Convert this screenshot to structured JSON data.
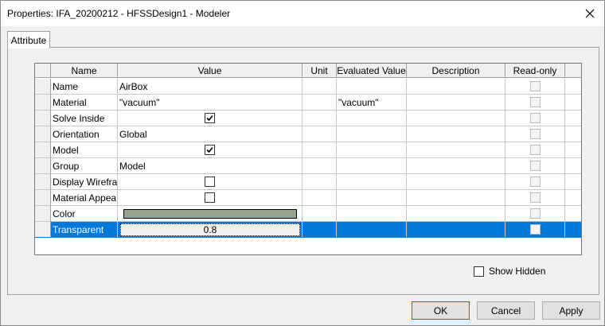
{
  "window": {
    "title": "Properties: IFA_20200212 - HFSSDesign1 - Modeler"
  },
  "tabs": [
    {
      "label": "Attribute"
    }
  ],
  "grid": {
    "columns": [
      "Name",
      "Value",
      "Unit",
      "Evaluated Value",
      "Description",
      "Read-only"
    ],
    "rows": [
      {
        "name": "Name",
        "value": "AirBox",
        "unit": "",
        "evaluated": "",
        "description": "",
        "value_type": "text"
      },
      {
        "name": "Material",
        "value": "\"vacuum\"",
        "unit": "",
        "evaluated": "\"vacuum\"",
        "description": "",
        "value_type": "text"
      },
      {
        "name": "Solve Inside",
        "value": "",
        "unit": "",
        "evaluated": "",
        "description": "",
        "value_type": "checkbox",
        "checked": true
      },
      {
        "name": "Orientation",
        "value": "Global",
        "unit": "",
        "evaluated": "",
        "description": "",
        "value_type": "text"
      },
      {
        "name": "Model",
        "value": "",
        "unit": "",
        "evaluated": "",
        "description": "",
        "value_type": "checkbox",
        "checked": true
      },
      {
        "name": "Group",
        "value": "Model",
        "unit": "",
        "evaluated": "",
        "description": "",
        "value_type": "text"
      },
      {
        "name": "Display Wirefra...",
        "value": "",
        "unit": "",
        "evaluated": "",
        "description": "",
        "value_type": "checkbox",
        "checked": false
      },
      {
        "name": "Material Appea...",
        "value": "",
        "unit": "",
        "evaluated": "",
        "description": "",
        "value_type": "checkbox",
        "checked": false
      },
      {
        "name": "Color",
        "value": "",
        "unit": "",
        "evaluated": "",
        "description": "",
        "value_type": "color",
        "color": "#95a58d"
      },
      {
        "name": "Transparent",
        "value": "0.8",
        "unit": "",
        "evaluated": "",
        "description": "",
        "value_type": "editor",
        "selected": true
      }
    ]
  },
  "show_hidden": {
    "label": "Show Hidden",
    "checked": false
  },
  "buttons": {
    "ok": "OK",
    "cancel": "Cancel",
    "apply": "Apply"
  },
  "colors": {
    "selection": "#0078d7",
    "swatch": "#95a58d"
  },
  "icons": {
    "close": "close-icon",
    "check": "check-icon"
  }
}
